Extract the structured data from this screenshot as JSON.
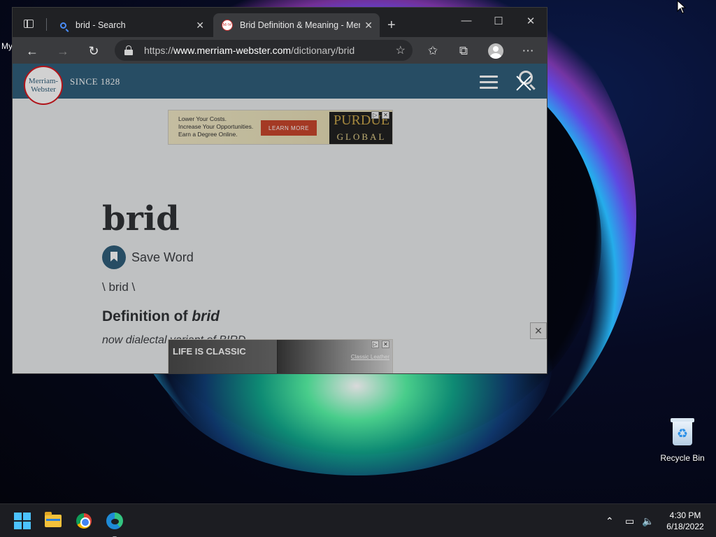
{
  "desktop": {
    "left_label": "My",
    "recycle_bin_label": "Recycle Bin"
  },
  "browser": {
    "tabs": [
      {
        "title": "brid - Search",
        "icon": "search-icon"
      },
      {
        "title": "Brid Definition & Meaning - Mer",
        "icon": "mw-favicon",
        "favicon_text": "M-W"
      }
    ],
    "url_prefix": "https://",
    "url_domain": "www.merriam-webster.com",
    "url_path": "/dictionary/brid"
  },
  "page": {
    "logo_text": "Merriam-Webster",
    "since": "SINCE 1828",
    "ad_top": {
      "line1": "Lower Your Costs.",
      "line2": "Increase Your Opportunities.",
      "line3": "Earn a Degree Online.",
      "cta": "LEARN MORE",
      "brand": "PURDUE",
      "brand_sub": "GLOBAL"
    },
    "word": "brid",
    "save_label": "Save Word",
    "pronunciation": "\\  brid \\",
    "definition_heading_prefix": "Definition of ",
    "definition_heading_word": "brid",
    "definition_line": "now dialectal variant of BIRD",
    "ad_bottom": {
      "left_text": "LIFE IS CLASSIC",
      "right_text": "Classic Leather"
    }
  },
  "taskbar": {
    "time": "4:30 PM",
    "date": "6/18/2022"
  },
  "colors": {
    "mw_header": "#305f7a",
    "taskbar_bg": "#1c1d22",
    "browser_chrome": "#202124",
    "toolbar": "#3a3b3e"
  }
}
